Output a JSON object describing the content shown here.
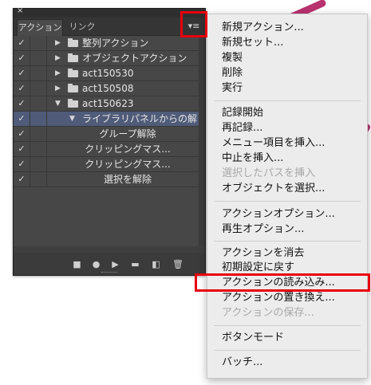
{
  "panel": {
    "tabs": [
      "アクション",
      "リンク"
    ],
    "close_glyph": "×",
    "menu_glyph": "▾≡",
    "rows": [
      {
        "check": "✓",
        "label": "整列アクション"
      },
      {
        "check": "✓",
        "label": "オブジェクトアクション"
      },
      {
        "check": "✓",
        "label": "act150530"
      },
      {
        "check": "✓",
        "label": "act150508"
      },
      {
        "check": "✓",
        "label": "act150623"
      },
      {
        "check": "✓",
        "label": "ライブラリパネルからの解"
      },
      {
        "check": "✓",
        "label": "グループ解除"
      },
      {
        "check": "✓",
        "label": "クリッピングマス..."
      },
      {
        "check": "✓",
        "label": "クリッピングマス..."
      },
      {
        "check": "✓",
        "label": "選択を解除"
      }
    ],
    "bottom_icons": [
      "stop-icon",
      "record-icon",
      "play-icon",
      "new-set-icon",
      "new-action-icon",
      "trash-icon"
    ]
  },
  "menu": {
    "groups": [
      [
        "新規アクション...",
        "新規セット...",
        "複製",
        "削除",
        "実行"
      ],
      [
        "記録開始",
        "再記録...",
        "メニュー項目を挿入...",
        "中止を挿入...",
        "選択したパスを挿入",
        "オブジェクトを選択..."
      ],
      [
        "アクションオプション...",
        "再生オプション..."
      ],
      [
        "アクションを消去",
        "初期設定に戻す",
        "アクションの読み込み...",
        "アクションの置き換え...",
        "アクションの保存..."
      ],
      [
        "ボタンモード"
      ],
      [
        "バッチ..."
      ]
    ],
    "disabled": [
      "選択したパスを挿入",
      "アクションの保存..."
    ]
  },
  "highlight_color": "#e8000d",
  "selection_color": "#4f5b78"
}
